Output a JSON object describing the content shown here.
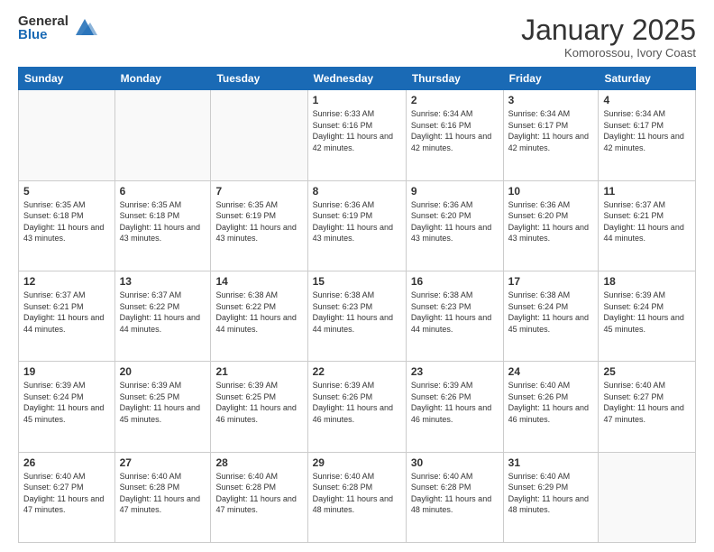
{
  "logo": {
    "general": "General",
    "blue": "Blue"
  },
  "header": {
    "month": "January 2025",
    "location": "Komorossou, Ivory Coast"
  },
  "days_of_week": [
    "Sunday",
    "Monday",
    "Tuesday",
    "Wednesday",
    "Thursday",
    "Friday",
    "Saturday"
  ],
  "weeks": [
    [
      {
        "day": "",
        "info": ""
      },
      {
        "day": "",
        "info": ""
      },
      {
        "day": "",
        "info": ""
      },
      {
        "day": "1",
        "info": "Sunrise: 6:33 AM\nSunset: 6:16 PM\nDaylight: 11 hours and 42 minutes."
      },
      {
        "day": "2",
        "info": "Sunrise: 6:34 AM\nSunset: 6:16 PM\nDaylight: 11 hours and 42 minutes."
      },
      {
        "day": "3",
        "info": "Sunrise: 6:34 AM\nSunset: 6:17 PM\nDaylight: 11 hours and 42 minutes."
      },
      {
        "day": "4",
        "info": "Sunrise: 6:34 AM\nSunset: 6:17 PM\nDaylight: 11 hours and 42 minutes."
      }
    ],
    [
      {
        "day": "5",
        "info": "Sunrise: 6:35 AM\nSunset: 6:18 PM\nDaylight: 11 hours and 43 minutes."
      },
      {
        "day": "6",
        "info": "Sunrise: 6:35 AM\nSunset: 6:18 PM\nDaylight: 11 hours and 43 minutes."
      },
      {
        "day": "7",
        "info": "Sunrise: 6:35 AM\nSunset: 6:19 PM\nDaylight: 11 hours and 43 minutes."
      },
      {
        "day": "8",
        "info": "Sunrise: 6:36 AM\nSunset: 6:19 PM\nDaylight: 11 hours and 43 minutes."
      },
      {
        "day": "9",
        "info": "Sunrise: 6:36 AM\nSunset: 6:20 PM\nDaylight: 11 hours and 43 minutes."
      },
      {
        "day": "10",
        "info": "Sunrise: 6:36 AM\nSunset: 6:20 PM\nDaylight: 11 hours and 43 minutes."
      },
      {
        "day": "11",
        "info": "Sunrise: 6:37 AM\nSunset: 6:21 PM\nDaylight: 11 hours and 44 minutes."
      }
    ],
    [
      {
        "day": "12",
        "info": "Sunrise: 6:37 AM\nSunset: 6:21 PM\nDaylight: 11 hours and 44 minutes."
      },
      {
        "day": "13",
        "info": "Sunrise: 6:37 AM\nSunset: 6:22 PM\nDaylight: 11 hours and 44 minutes."
      },
      {
        "day": "14",
        "info": "Sunrise: 6:38 AM\nSunset: 6:22 PM\nDaylight: 11 hours and 44 minutes."
      },
      {
        "day": "15",
        "info": "Sunrise: 6:38 AM\nSunset: 6:23 PM\nDaylight: 11 hours and 44 minutes."
      },
      {
        "day": "16",
        "info": "Sunrise: 6:38 AM\nSunset: 6:23 PM\nDaylight: 11 hours and 44 minutes."
      },
      {
        "day": "17",
        "info": "Sunrise: 6:38 AM\nSunset: 6:24 PM\nDaylight: 11 hours and 45 minutes."
      },
      {
        "day": "18",
        "info": "Sunrise: 6:39 AM\nSunset: 6:24 PM\nDaylight: 11 hours and 45 minutes."
      }
    ],
    [
      {
        "day": "19",
        "info": "Sunrise: 6:39 AM\nSunset: 6:24 PM\nDaylight: 11 hours and 45 minutes."
      },
      {
        "day": "20",
        "info": "Sunrise: 6:39 AM\nSunset: 6:25 PM\nDaylight: 11 hours and 45 minutes."
      },
      {
        "day": "21",
        "info": "Sunrise: 6:39 AM\nSunset: 6:25 PM\nDaylight: 11 hours and 46 minutes."
      },
      {
        "day": "22",
        "info": "Sunrise: 6:39 AM\nSunset: 6:26 PM\nDaylight: 11 hours and 46 minutes."
      },
      {
        "day": "23",
        "info": "Sunrise: 6:39 AM\nSunset: 6:26 PM\nDaylight: 11 hours and 46 minutes."
      },
      {
        "day": "24",
        "info": "Sunrise: 6:40 AM\nSunset: 6:26 PM\nDaylight: 11 hours and 46 minutes."
      },
      {
        "day": "25",
        "info": "Sunrise: 6:40 AM\nSunset: 6:27 PM\nDaylight: 11 hours and 47 minutes."
      }
    ],
    [
      {
        "day": "26",
        "info": "Sunrise: 6:40 AM\nSunset: 6:27 PM\nDaylight: 11 hours and 47 minutes."
      },
      {
        "day": "27",
        "info": "Sunrise: 6:40 AM\nSunset: 6:28 PM\nDaylight: 11 hours and 47 minutes."
      },
      {
        "day": "28",
        "info": "Sunrise: 6:40 AM\nSunset: 6:28 PM\nDaylight: 11 hours and 47 minutes."
      },
      {
        "day": "29",
        "info": "Sunrise: 6:40 AM\nSunset: 6:28 PM\nDaylight: 11 hours and 48 minutes."
      },
      {
        "day": "30",
        "info": "Sunrise: 6:40 AM\nSunset: 6:28 PM\nDaylight: 11 hours and 48 minutes."
      },
      {
        "day": "31",
        "info": "Sunrise: 6:40 AM\nSunset: 6:29 PM\nDaylight: 11 hours and 48 minutes."
      },
      {
        "day": "",
        "info": ""
      }
    ]
  ]
}
